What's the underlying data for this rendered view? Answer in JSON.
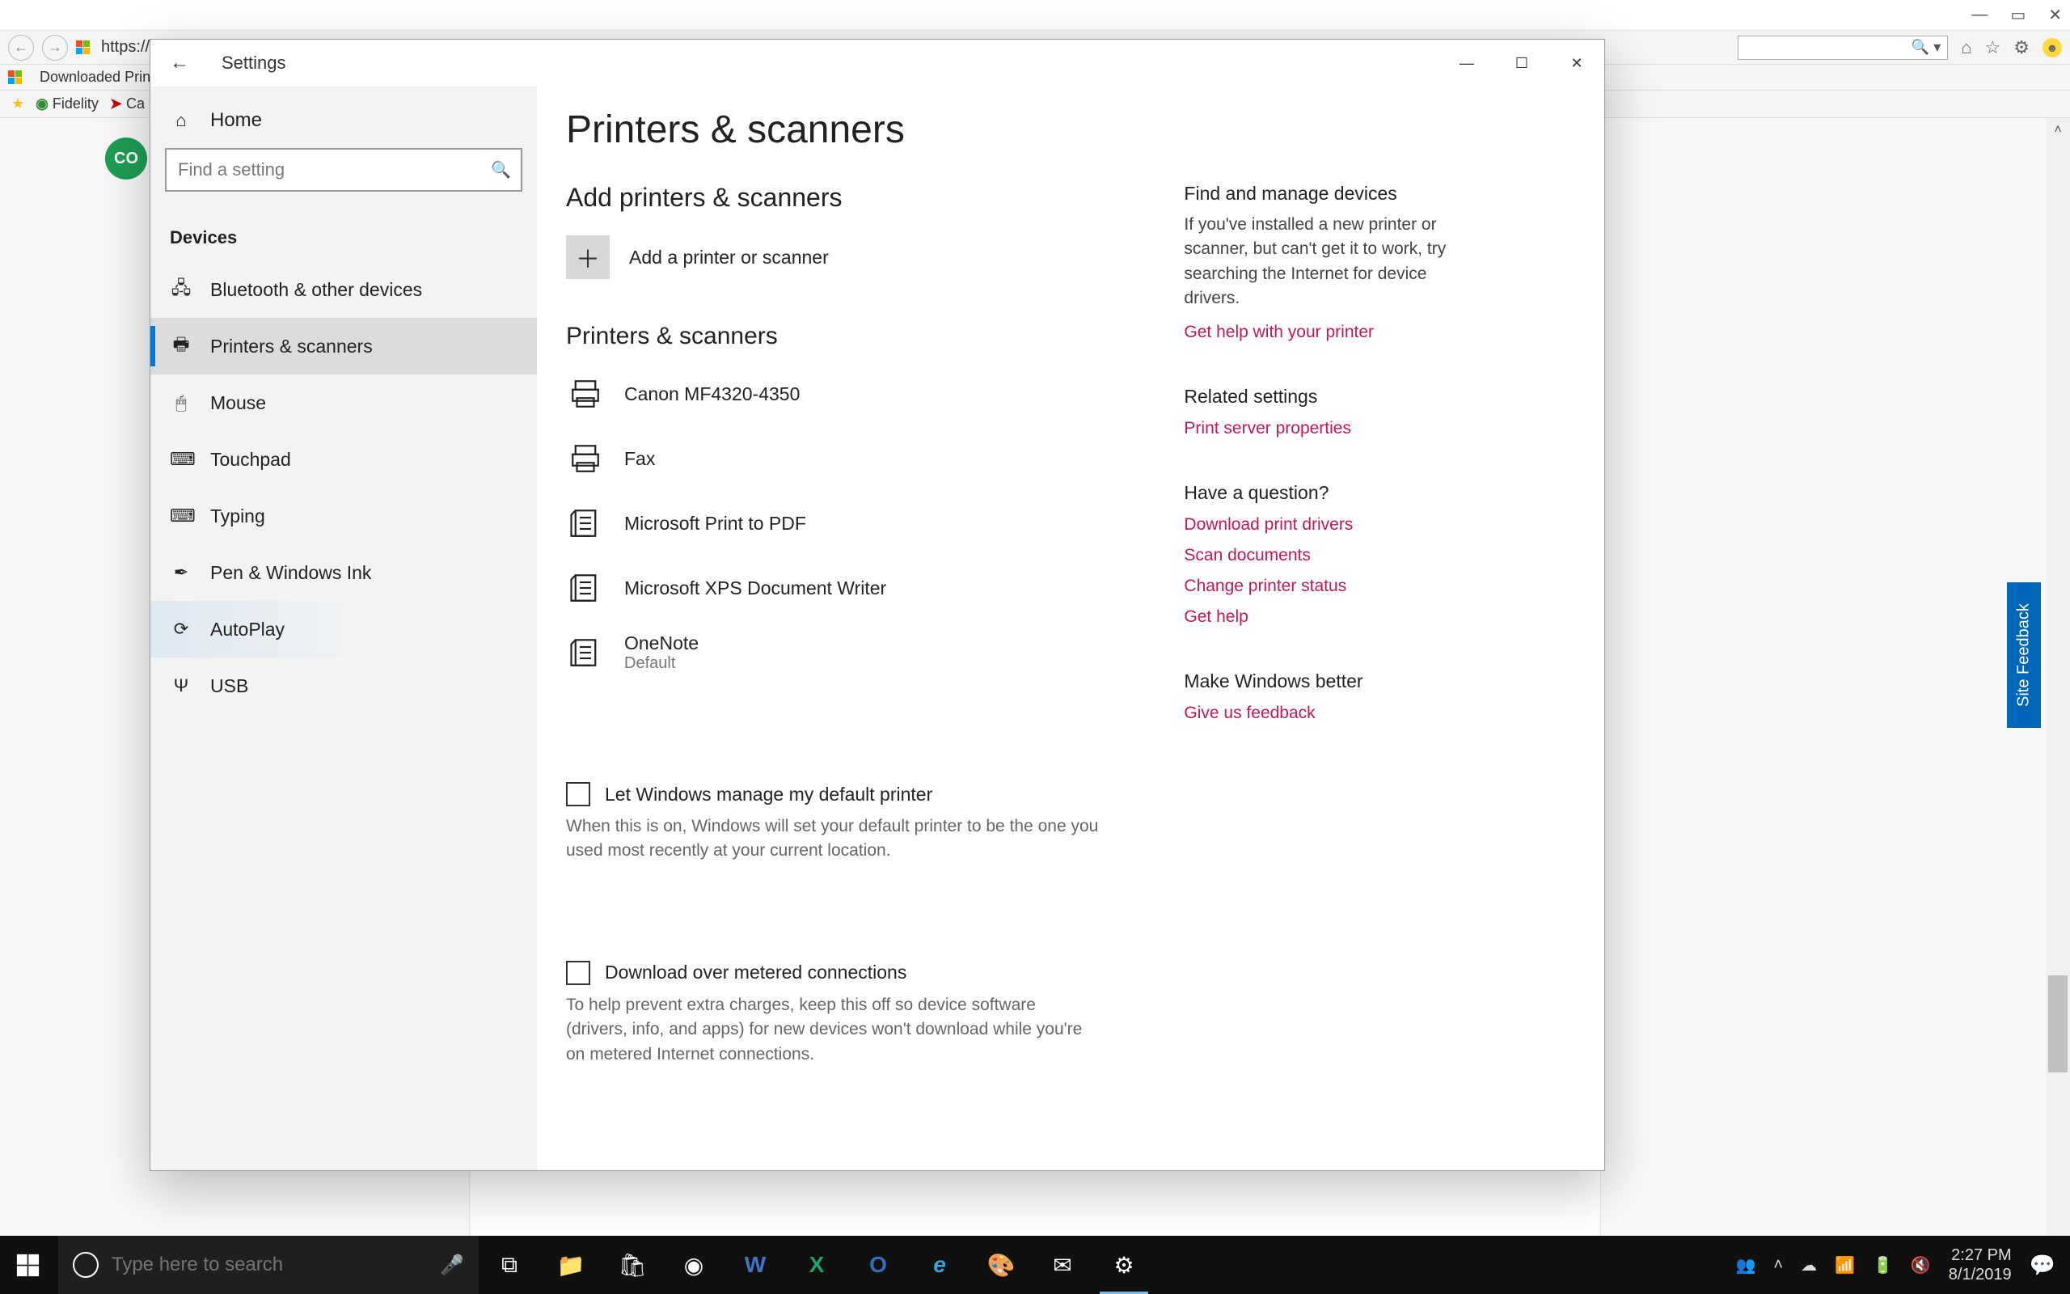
{
  "browser": {
    "url_prefix": "https://a",
    "window_buttons": {
      "min": "—",
      "max": "▭",
      "close": "✕"
    },
    "bookmarks_row1_tab": "Downloaded Printe",
    "bookmarks_row2": {
      "star": "★",
      "fav1": "Fidelity",
      "fav2": "Ca"
    },
    "toolbar_right_glyphs": {
      "home": "⌂",
      "star": "☆",
      "gear": "⚙"
    },
    "search_glyph": "🔍 ▾"
  },
  "avatar": "CO",
  "feedback_tab": "Site Feedback",
  "settings": {
    "back_glyph": "←",
    "title": "Settings",
    "window_buttons": {
      "min": "—",
      "max": "☐",
      "close": "✕"
    },
    "home_label": "Home",
    "home_icon": "⌂",
    "search_placeholder": "Find a setting",
    "search_icon": "🔍",
    "group_header": "Devices",
    "nav": [
      {
        "icon": "🖧",
        "label": "Bluetooth & other devices"
      },
      {
        "icon": "🖶",
        "label": "Printers & scanners",
        "active": true
      },
      {
        "icon": "🖱",
        "label": "Mouse"
      },
      {
        "icon": "⌨",
        "label": "Touchpad"
      },
      {
        "icon": "⌨",
        "label": "Typing"
      },
      {
        "icon": "✒",
        "label": "Pen & Windows Ink"
      },
      {
        "icon": "⟳",
        "label": "AutoPlay",
        "hover": true
      },
      {
        "icon": "Ψ",
        "label": "USB"
      }
    ],
    "page_title": "Printers & scanners",
    "section_add_h": "Add printers & scanners",
    "add_button_label": "Add a printer or scanner",
    "plus_glyph": "＋",
    "section_list_h": "Printers & scanners",
    "printers": [
      {
        "name": "Canon MF4320-4350",
        "sub": "",
        "type": "printer"
      },
      {
        "name": "Fax",
        "sub": "",
        "type": "printer"
      },
      {
        "name": "Microsoft Print to PDF",
        "sub": "",
        "type": "virtual"
      },
      {
        "name": "Microsoft XPS Document Writer",
        "sub": "",
        "type": "virtual"
      },
      {
        "name": "OneNote",
        "sub": "Default",
        "type": "virtual"
      }
    ],
    "checkbox1_label": "Let Windows manage my default printer",
    "checkbox1_help": "When this is on, Windows will set your default printer to be the one you used most recently at your current location.",
    "checkbox2_label": "Download over metered connections",
    "checkbox2_help": "To help prevent extra charges, keep this off so device software (drivers, info, and apps) for new devices won't download while you're on metered Internet connections.",
    "side": {
      "b1_h": "Find and manage devices",
      "b1_p": "If you've installed a new printer or scanner, but can't get it to work, try searching the Internet for device drivers.",
      "b1_link": "Get help with your printer",
      "b2_h": "Related settings",
      "b2_link": "Print server properties",
      "b3_h": "Have a question?",
      "b3_links": [
        "Download print drivers",
        "Scan documents",
        "Change printer status",
        "Get help"
      ],
      "b4_h": "Make Windows better",
      "b4_link": "Give us feedback"
    }
  },
  "taskbar": {
    "search_placeholder": "Type here to search",
    "mic": "🎤",
    "timeline": "⧉",
    "icons": [
      "📁",
      "🛍",
      "◉",
      "W",
      "X",
      "O",
      "e",
      "🎨",
      "✉",
      "⚙"
    ],
    "active_index": 9,
    "tray": {
      "people": "👥",
      "up": "˄",
      "cloud": "☁",
      "wifi": "📶",
      "batt": "🔋",
      "vol": "🔇"
    },
    "time": "2:27 PM",
    "date": "8/1/2019",
    "notif": "💬"
  }
}
